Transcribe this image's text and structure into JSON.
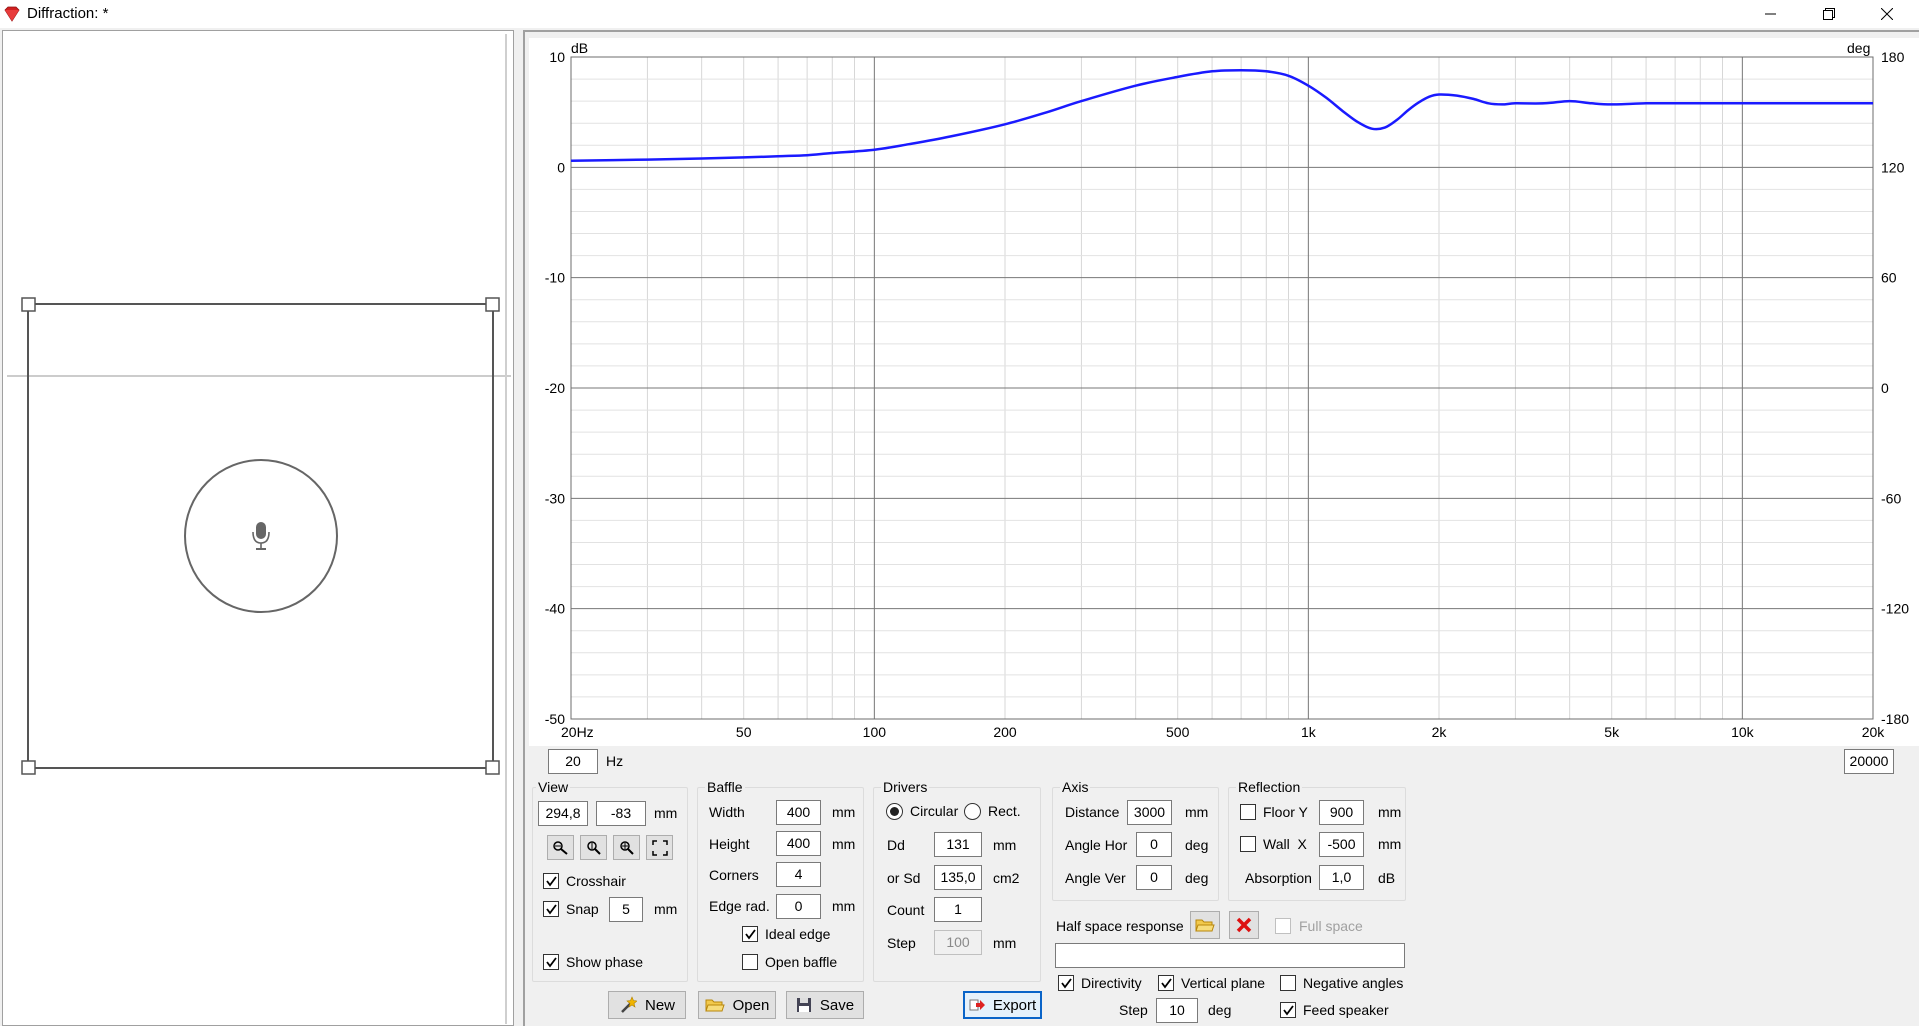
{
  "window": {
    "title": "Diffraction: *",
    "controls": [
      "minimize-icon",
      "restore-icon",
      "close-icon"
    ]
  },
  "chart_data": {
    "type": "line",
    "x_scale": "log",
    "xlim": [
      20,
      20000
    ],
    "ylim": [
      -50,
      10
    ],
    "y2lim": [
      -180,
      180
    ],
    "ylabel": "dB",
    "y2label": "deg",
    "x_ticks": [
      "20Hz",
      "50",
      "100",
      "200",
      "500",
      "1k",
      "2k",
      "5k",
      "10k",
      "20k"
    ],
    "y_ticks": [
      "10",
      "0",
      "-10",
      "-20",
      "-30",
      "-40",
      "-50"
    ],
    "y2_ticks": [
      "180",
      "120",
      "60",
      "0",
      "-60",
      "-120",
      "-180"
    ],
    "grid": true,
    "series": [
      {
        "color": "#1a1aff",
        "x": [
          20,
          30,
          40,
          50,
          60,
          70,
          80,
          100,
          120,
          150,
          200,
          250,
          300,
          400,
          500,
          600,
          700,
          800,
          900,
          1000,
          1100,
          1200,
          1300,
          1400,
          1500,
          1600,
          1700,
          1800,
          1900,
          2000,
          2200,
          2400,
          2600,
          2800,
          3000,
          3500,
          4000,
          4500,
          5000,
          6000,
          7000,
          8000,
          10000,
          12000,
          15000,
          20000
        ],
        "y": [
          0.6,
          0.7,
          0.8,
          0.9,
          1.0,
          1.1,
          1.3,
          1.6,
          2.1,
          2.8,
          3.9,
          5.0,
          6.0,
          7.4,
          8.2,
          8.7,
          8.8,
          8.7,
          8.3,
          7.4,
          6.3,
          5.1,
          4.1,
          3.5,
          3.6,
          4.3,
          5.2,
          5.9,
          6.4,
          6.6,
          6.5,
          6.2,
          5.8,
          5.7,
          5.8,
          5.8,
          6.0,
          5.8,
          5.7,
          5.8,
          5.8,
          5.8,
          5.8,
          5.8,
          5.8,
          5.8
        ]
      }
    ]
  },
  "range": {
    "from": "20",
    "hz_unit": "Hz",
    "to": "20000"
  },
  "view": {
    "title": "View",
    "x": "294,8",
    "y": "-83",
    "unit": "mm",
    "icons": [
      "zoom-out-icon",
      "zoom-fit-icon",
      "zoom-in-icon",
      "fullscreen-icon"
    ],
    "crosshair_label": "Crosshair",
    "snap_label": "Snap",
    "snap_value": "5",
    "snap_unit": "mm",
    "show_phase_label": "Show phase"
  },
  "baffle": {
    "title": "Baffle",
    "width_label": "Width",
    "width": "400",
    "width_unit": "mm",
    "height_label": "Height",
    "height": "400",
    "height_unit": "mm",
    "corners_label": "Corners",
    "corners": "4",
    "edge_label": "Edge rad.",
    "edge": "0",
    "edge_unit": "mm",
    "ideal_edge_label": "Ideal edge",
    "open_baffle_label": "Open baffle"
  },
  "drivers": {
    "title": "Drivers",
    "circular_label": "Circular",
    "rect_label": "Rect.",
    "dd_label": "Dd",
    "dd": "131",
    "dd_unit": "mm",
    "sd_label": "or Sd",
    "sd": "135,0",
    "sd_unit": "cm2",
    "count_label": "Count",
    "count": "1",
    "step_label": "Step",
    "step": "100",
    "step_unit": "mm"
  },
  "axis": {
    "title": "Axis",
    "distance_label": "Distance",
    "distance": "3000",
    "distance_unit": "mm",
    "angle_hor_label": "Angle Hor",
    "angle_hor": "0",
    "angle_hor_unit": "deg",
    "angle_ver_label": "Angle Ver",
    "angle_ver": "0",
    "angle_ver_unit": "deg"
  },
  "reflection": {
    "title": "Reflection",
    "floor_label": "Floor Y",
    "floor": "900",
    "floor_unit": "mm",
    "wall_label": "Wall  X",
    "wall": "-500",
    "wall_unit": "mm",
    "absorption_label": "Absorption",
    "absorption": "1,0",
    "absorption_unit": "dB"
  },
  "half_space": {
    "label": "Half space response",
    "full_space_label": "Full space",
    "file_value": ""
  },
  "options": {
    "directivity_label": "Directivity",
    "vertical_plane_label": "Vertical plane",
    "negative_angles_label": "Negative angles",
    "step_label": "Step",
    "step": "10",
    "step_unit": "deg",
    "feed_speaker_label": "Feed speaker"
  },
  "buttons": {
    "new": "New",
    "open": "Open",
    "save": "Save",
    "export": "Export"
  }
}
